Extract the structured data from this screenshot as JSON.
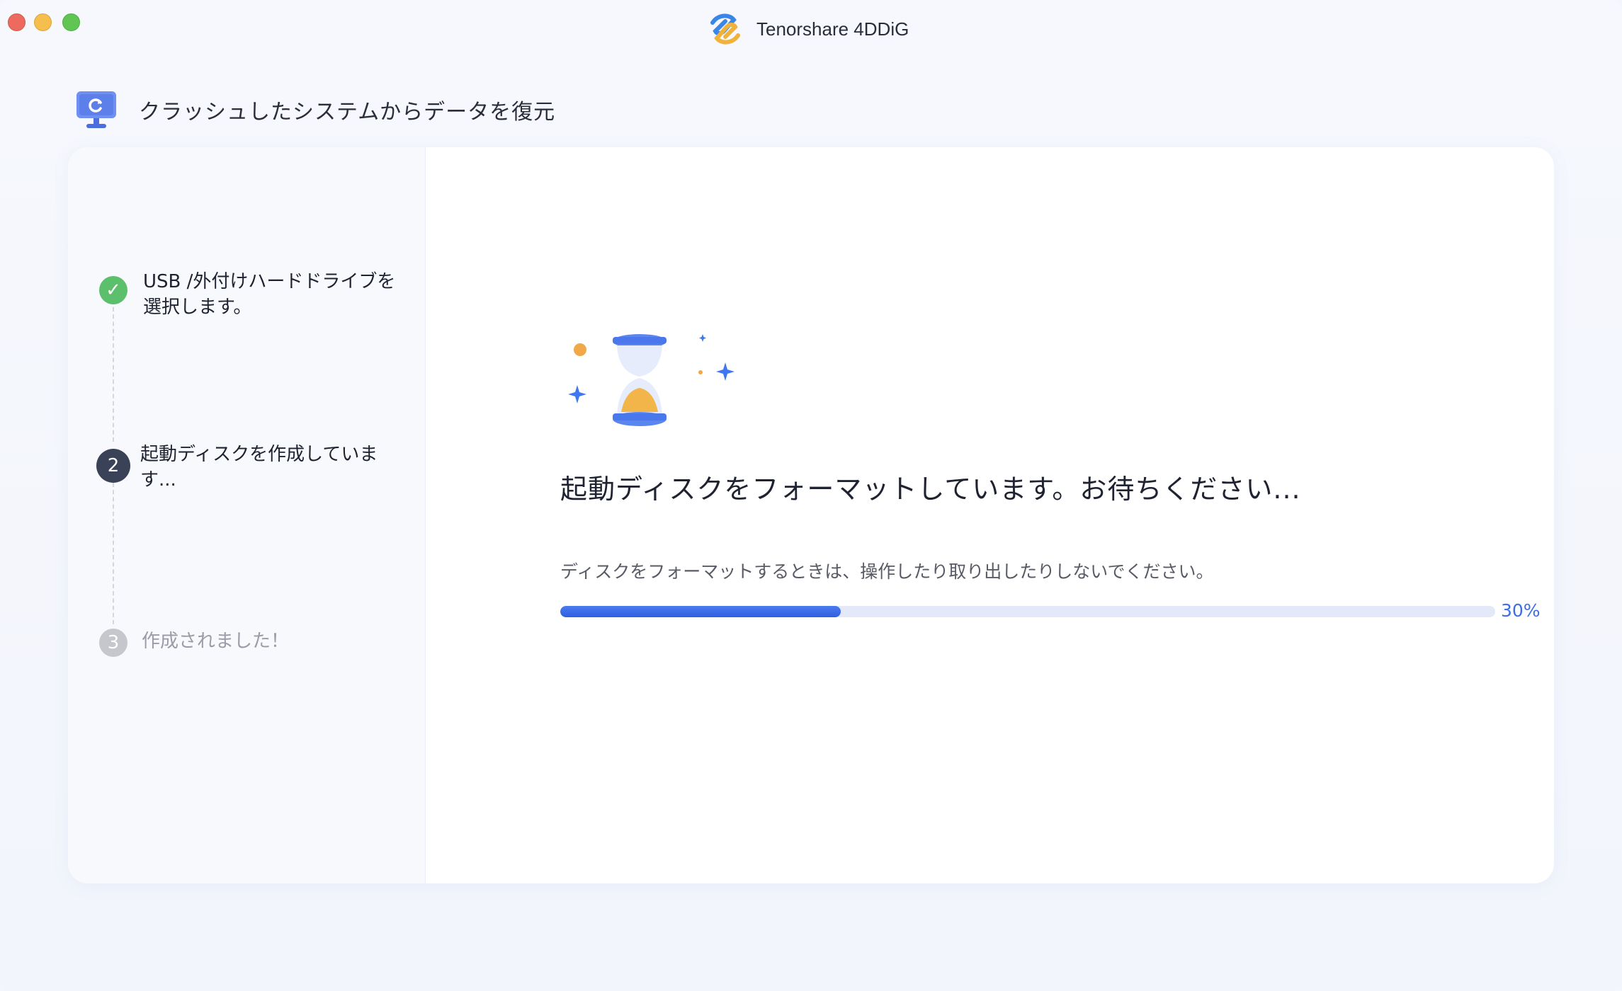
{
  "window": {
    "title": "Tenorshare 4DDiG",
    "buttons": [
      "close",
      "minimize",
      "zoom"
    ],
    "logo_icon": "tenorshare-logo-icon"
  },
  "header": {
    "title": "クラッシュしたシステムからデータを復元",
    "icon": "monitor-restore-icon"
  },
  "steps": [
    {
      "label": "USB /外付けハードドライブを選択します。",
      "state": "done",
      "marker": "✓"
    },
    {
      "label": "起動ディスクを作成しています...",
      "state": "active",
      "marker": "2"
    },
    {
      "label": "作成されました！",
      "state": "pending",
      "marker": "3"
    }
  ],
  "main": {
    "title": "起動ディスクをフォーマットしています。お待ちください...",
    "subtitle": "ディスクをフォーマットするときは、操作したり取り出したりしないでください。",
    "progress_value": 30,
    "progress_label": "30%",
    "illustration": "hourglass-icon"
  },
  "colors": {
    "accent": "#3d6ee6",
    "done": "#5cbf6c",
    "active": "#3a4257",
    "pending": "#c5c7cd"
  }
}
